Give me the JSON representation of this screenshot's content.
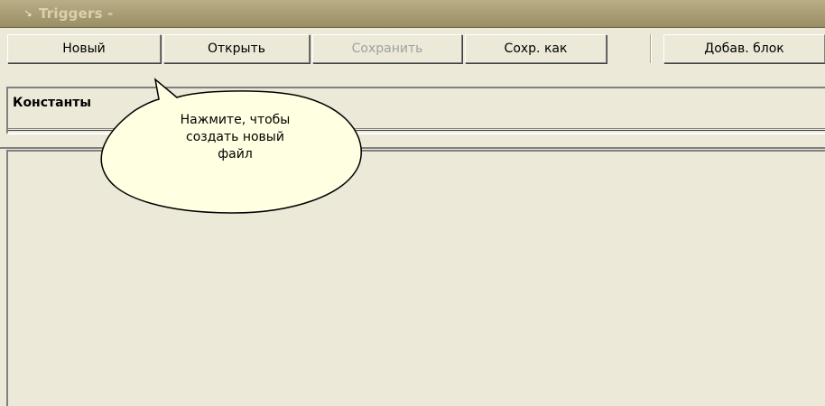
{
  "window": {
    "title": "Triggers -",
    "icon": "window-icon"
  },
  "toolbar": {
    "buttons": [
      {
        "label": "Новый",
        "enabled": true
      },
      {
        "label": "Открыть",
        "enabled": true
      },
      {
        "label": "Сохранить",
        "enabled": false
      },
      {
        "label": "Сохр. как",
        "enabled": true
      },
      {
        "label": "Добав. блок",
        "enabled": true
      }
    ]
  },
  "constants": {
    "label": "Константы"
  },
  "tooltip": {
    "lines": [
      "Нажмите, чтобы",
      "создать новый",
      "файл"
    ],
    "background": "#ffffe1"
  },
  "colors": {
    "title_bar": "#a89c73",
    "title_text": "#d9d0ad",
    "panel": "#ece9d8",
    "disabled_text": "#a0a0a0"
  }
}
